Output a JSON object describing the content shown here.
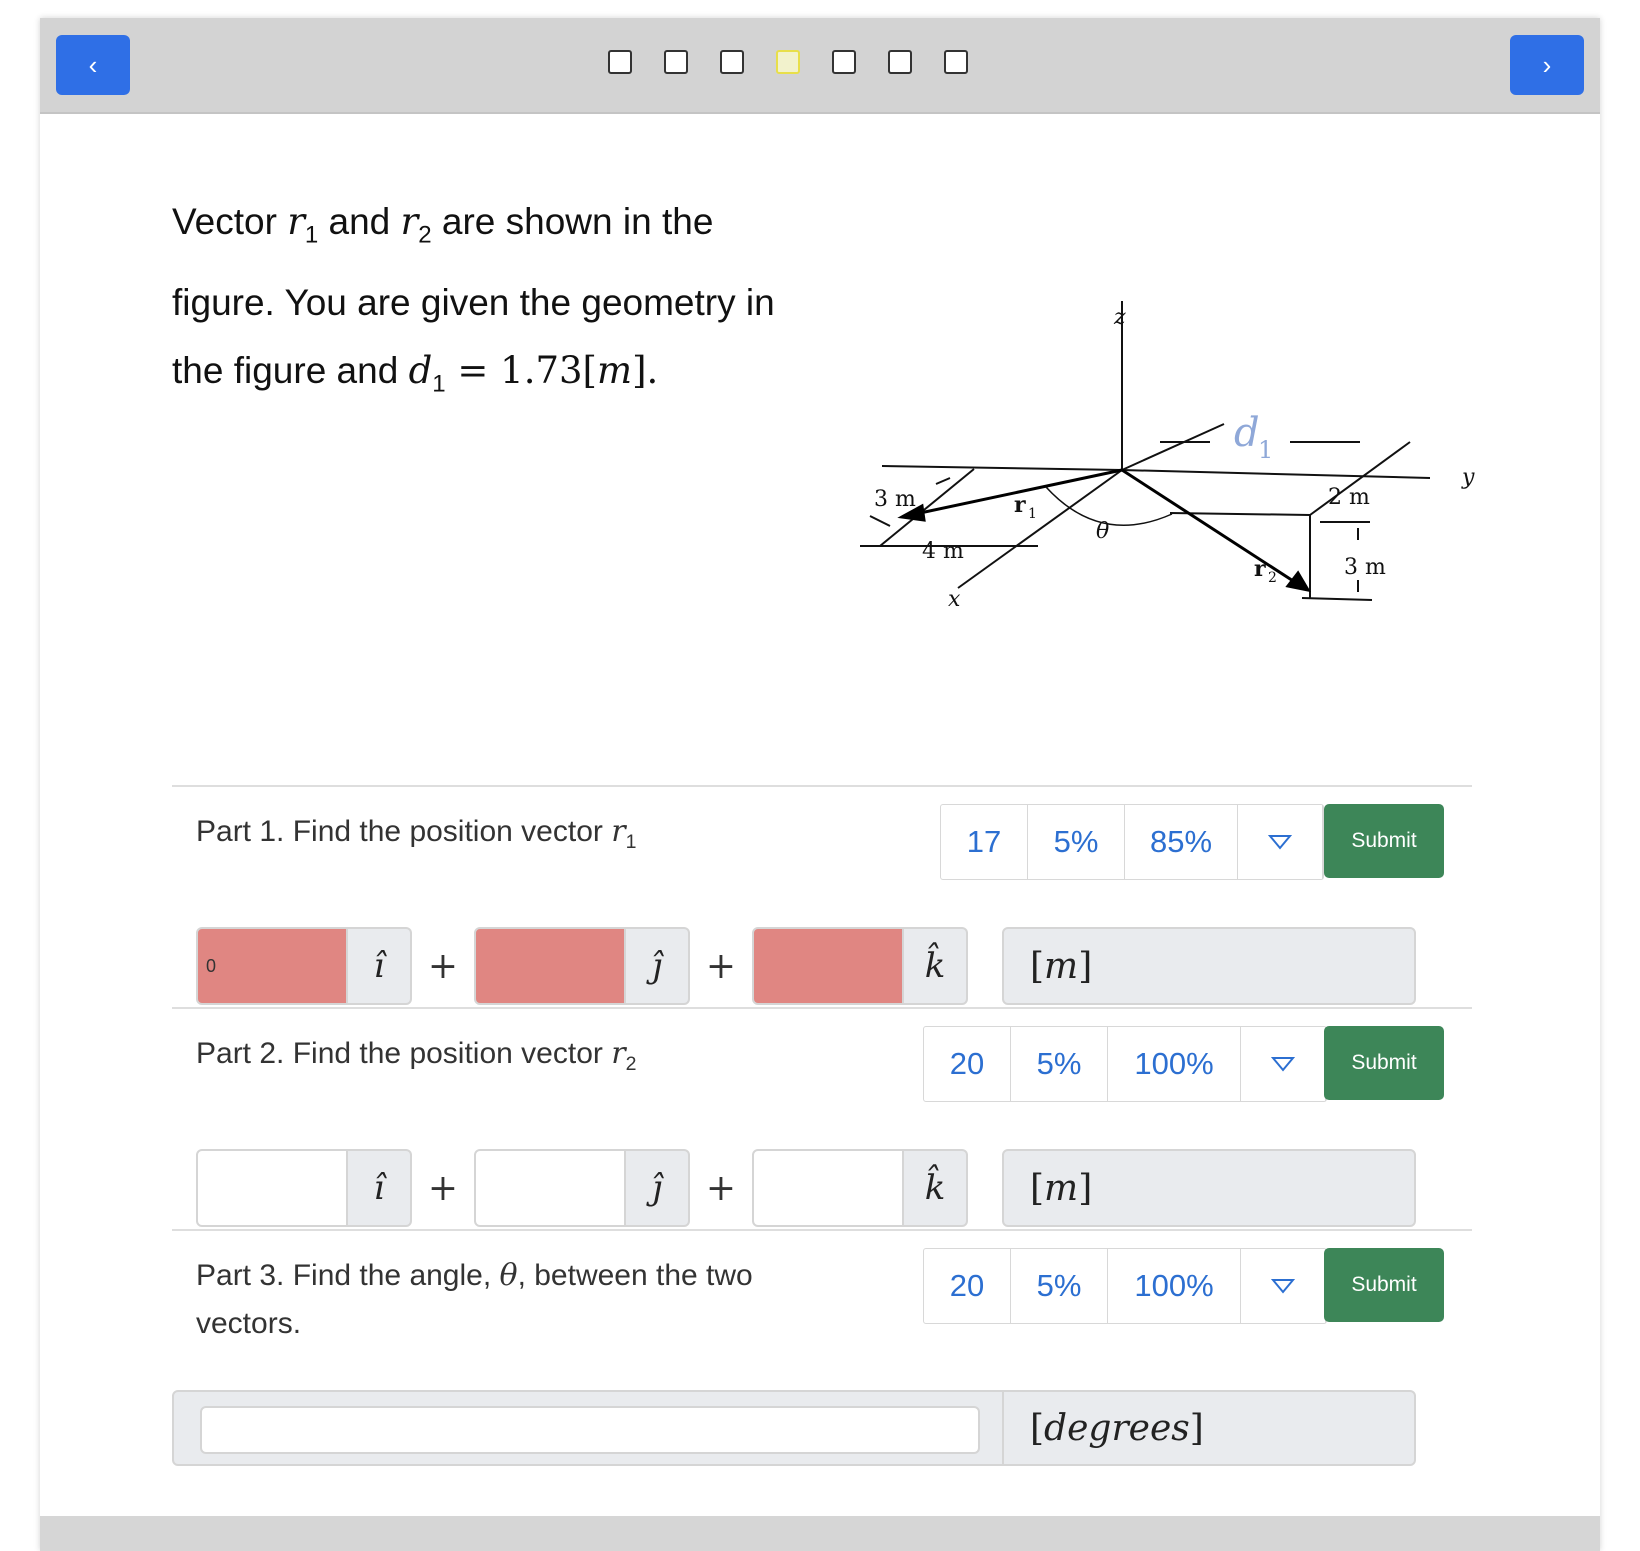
{
  "nav": {
    "prev_icon": "chevron-left-icon",
    "prev_glyph": "‹",
    "next_icon": "chevron-right-icon",
    "next_glyph": "›",
    "questions": [
      {
        "active": false
      },
      {
        "active": false
      },
      {
        "active": false
      },
      {
        "active": true
      },
      {
        "active": false
      },
      {
        "active": false
      },
      {
        "active": false
      }
    ]
  },
  "intro": {
    "t1": "Vector ",
    "r": "r",
    "sub1": "1",
    "t2": " and ",
    "sub2": "2",
    "t3": " are shown in the figure. You are given the geometry in the figure and ",
    "d": "d",
    "eq": " = 1.73[",
    "m": "m",
    "end": "]."
  },
  "figure": {
    "z": "z",
    "y": "y",
    "x": "x",
    "r1": "r",
    "r1_sub": "1",
    "r2": "r",
    "r2_sub": "2",
    "theta": "θ",
    "d1": "d",
    "d1_sub": "1",
    "dim_3m_left": "3 m",
    "dim_4m": "4 m",
    "dim_2m": "2 m",
    "dim_3m_right": "3 m"
  },
  "parts": [
    {
      "title_text": "Part 1. Find the position vector ",
      "vec": "r",
      "vec_sub": "1",
      "stats": [
        "17",
        "5%",
        "85%"
      ],
      "submit": "Submit",
      "inputs": [
        "0",
        "",
        ""
      ],
      "unit_vectors": [
        "î",
        "ĵ",
        "k̂"
      ],
      "plus": "+",
      "unit": "m"
    },
    {
      "title_text": "Part 2. Find the position vector ",
      "vec": "r",
      "vec_sub": "2",
      "stats": [
        "20",
        "5%",
        "100%"
      ],
      "submit": "Submit",
      "inputs": [
        "",
        "",
        ""
      ],
      "unit_vectors": [
        "î",
        "ĵ",
        "k̂"
      ],
      "plus": "+",
      "unit": "m"
    },
    {
      "title_pre": "Part 3. Find the angle, ",
      "theta": "θ",
      "title_post": ", between the two vectors.",
      "stats": [
        "20",
        "5%",
        "100%"
      ],
      "submit": "Submit",
      "input": "",
      "unit": "degrees"
    }
  ],
  "colors": {
    "nav_button": "#2f6fe6",
    "submit": "#3d8658",
    "stat_text": "#2c6fd1",
    "incorrect_input": "#e08682",
    "active_question": "#e8df4a"
  }
}
